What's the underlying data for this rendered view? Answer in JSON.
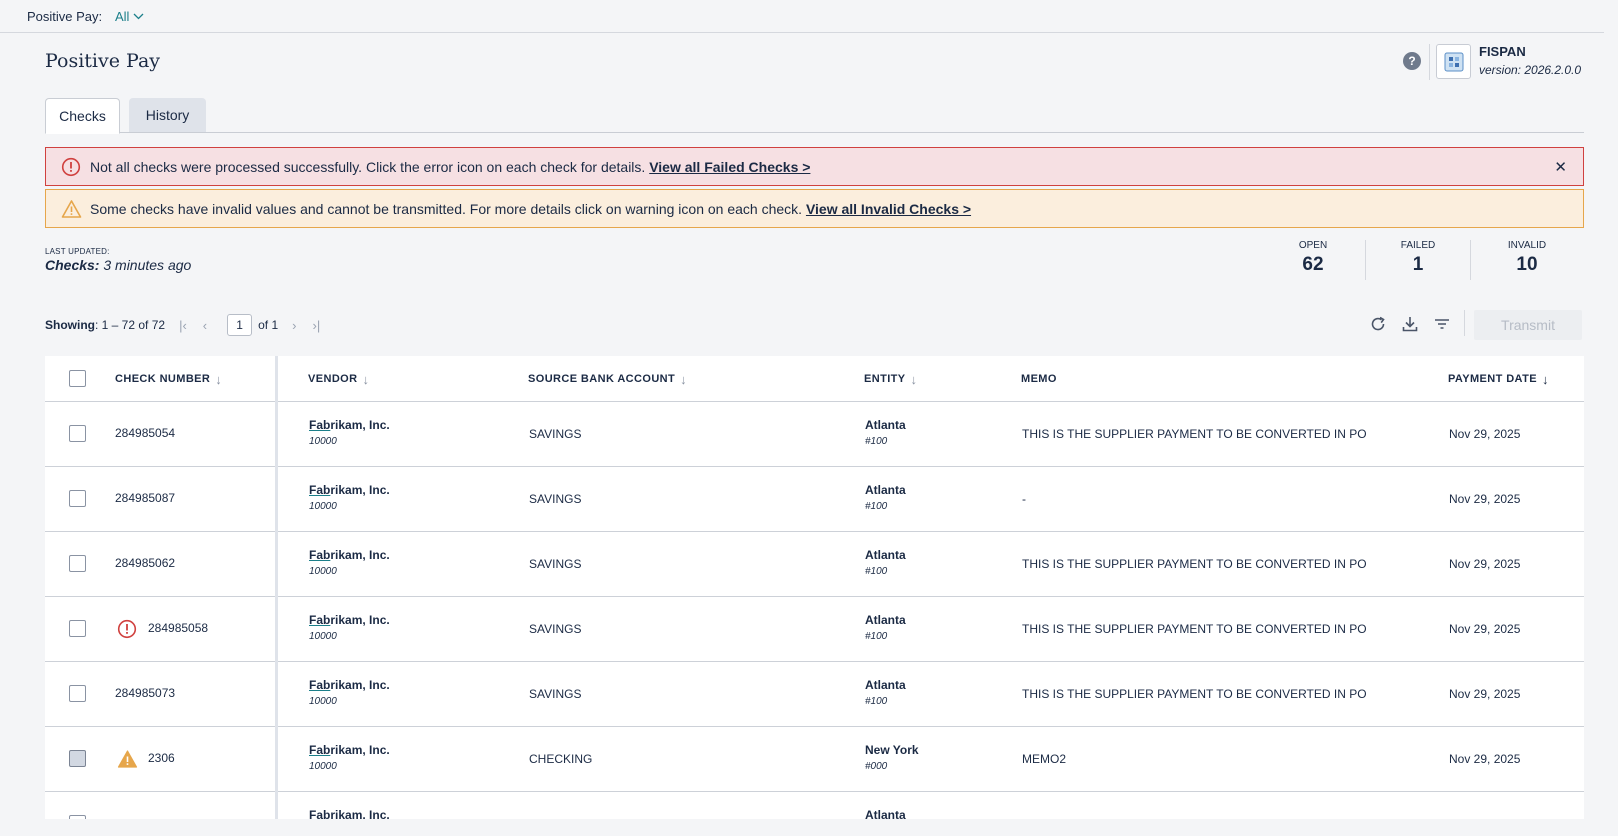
{
  "filter": {
    "label": "Positive Pay:",
    "value": "All"
  },
  "page_title": "Positive Pay",
  "brand": {
    "name": "FISPAN",
    "version": "version: 2026.2.0.0"
  },
  "tabs": [
    {
      "label": "Checks"
    },
    {
      "label": "History"
    }
  ],
  "alerts": {
    "error": {
      "text": "Not all checks were processed successfully. Click the error icon on each check for details. ",
      "link": "View all Failed Checks >"
    },
    "warning": {
      "text": "Some checks have invalid values and cannot be transmitted. For more details click on warning icon on each check. ",
      "link": "View all Invalid Checks >"
    }
  },
  "last_updated": {
    "label": "LAST UPDATED:",
    "prefix": "Checks:",
    "value": " 3 minutes ago"
  },
  "stats": [
    {
      "label": "OPEN",
      "value": "62"
    },
    {
      "label": "FAILED",
      "value": "1"
    },
    {
      "label": "INVALID",
      "value": "10"
    }
  ],
  "pager": {
    "showing_label": "Showing",
    "range": ": 1 – 72 of 72",
    "page": "1",
    "of": "of 1"
  },
  "toolbar": {
    "transmit_label": "Transmit"
  },
  "columns": {
    "check_number": "CHECK NUMBER",
    "vendor": "VENDOR",
    "source_bank_account": "SOURCE BANK ACCOUNT",
    "entity": "ENTITY",
    "memo": "MEMO",
    "payment_date": "PAYMENT DATE"
  },
  "rows": [
    {
      "check": "284985054",
      "status": "",
      "vendor": "Fabrikam, Inc.",
      "vendor_id": "10000",
      "account": "SAVINGS",
      "entity": "Atlanta",
      "entity_id": "#100",
      "memo": "THIS IS THE SUPPLIER PAYMENT TO BE CONVERTED IN PO",
      "date": "Nov 29, 2025"
    },
    {
      "check": "284985087",
      "status": "",
      "vendor": "Fabrikam, Inc.",
      "vendor_id": "10000",
      "account": "SAVINGS",
      "entity": "Atlanta",
      "entity_id": "#100",
      "memo": "-",
      "date": "Nov 29, 2025"
    },
    {
      "check": "284985062",
      "status": "",
      "vendor": "Fabrikam, Inc.",
      "vendor_id": "10000",
      "account": "SAVINGS",
      "entity": "Atlanta",
      "entity_id": "#100",
      "memo": "THIS IS THE SUPPLIER PAYMENT TO BE CONVERTED IN PO",
      "date": "Nov 29, 2025"
    },
    {
      "check": "284985058",
      "status": "error",
      "vendor": "Fabrikam, Inc.",
      "vendor_id": "10000",
      "account": "SAVINGS",
      "entity": "Atlanta",
      "entity_id": "#100",
      "memo": "THIS IS THE SUPPLIER PAYMENT TO BE CONVERTED IN PO",
      "date": "Nov 29, 2025"
    },
    {
      "check": "284985073",
      "status": "",
      "vendor": "Fabrikam, Inc.",
      "vendor_id": "10000",
      "account": "SAVINGS",
      "entity": "Atlanta",
      "entity_id": "#100",
      "memo": "THIS IS THE SUPPLIER PAYMENT TO BE CONVERTED IN PO",
      "date": "Nov 29, 2025"
    },
    {
      "check": "2306",
      "status": "warning",
      "vendor": "Fabrikam, Inc.",
      "vendor_id": "10000",
      "account": "CHECKING",
      "entity": "New York",
      "entity_id": "#000",
      "memo": "MEMO2",
      "date": "Nov 29, 2025"
    },
    {
      "check": "",
      "status": "",
      "vendor": "Fabrikam, Inc.",
      "vendor_id": "",
      "account": "",
      "entity": "Atlanta",
      "entity_id": "",
      "memo": "",
      "date": ""
    }
  ],
  "colors": {
    "accent": "#1b7f8a",
    "error": "#d0413f",
    "warning": "#e6a64b",
    "text": "#1b2a44"
  },
  "icons": [
    "chevron-down-icon",
    "help-icon",
    "error-icon",
    "warning-icon",
    "close-icon",
    "first-page-icon",
    "prev-page-icon",
    "next-page-icon",
    "last-page-icon",
    "refresh-icon",
    "download-icon",
    "filter-icon",
    "sort-down-icon"
  ]
}
